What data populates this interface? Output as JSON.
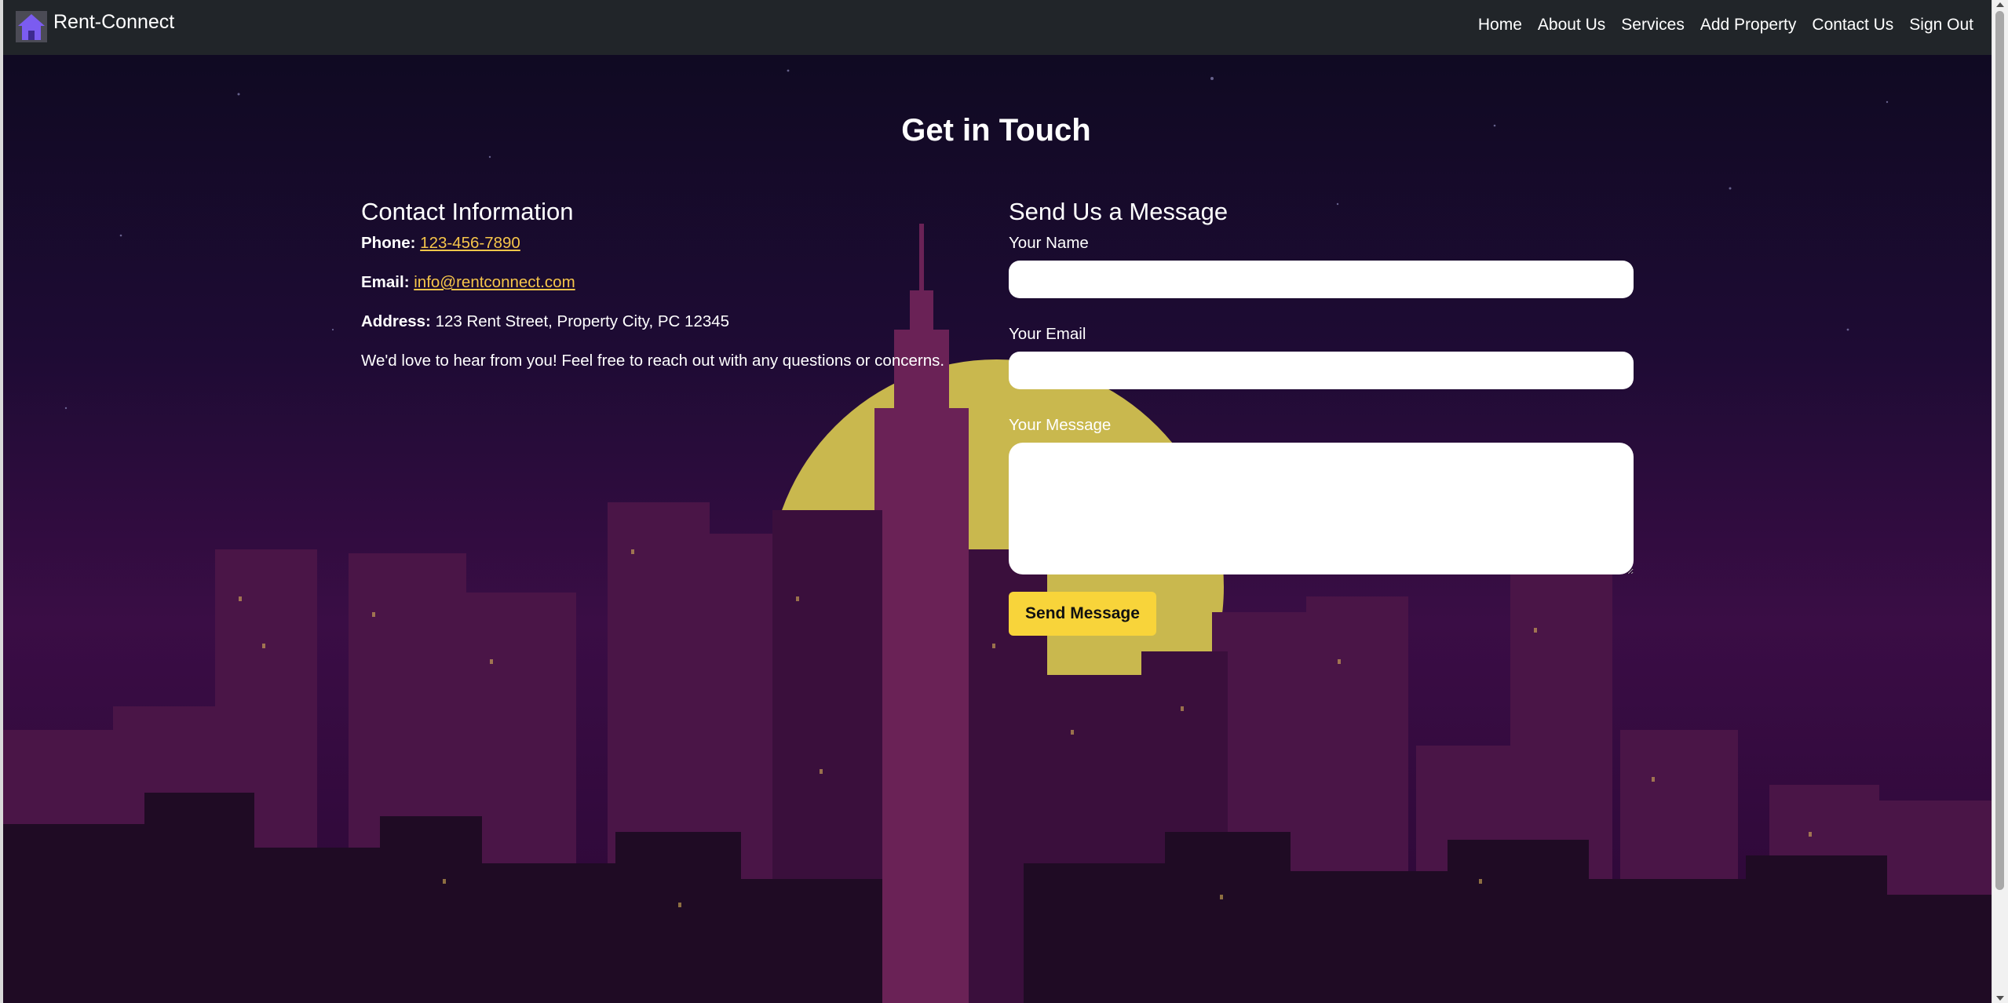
{
  "navbar": {
    "brand": "Rent-Connect",
    "brand_icon": "house-icon",
    "links": [
      "Home",
      "About Us",
      "Services",
      "Add Property",
      "Contact Us",
      "Sign Out"
    ]
  },
  "page": {
    "title": "Get in Touch"
  },
  "contact_info": {
    "heading": "Contact Information",
    "phone_label": "Phone:",
    "phone": "123-456-7890",
    "email_label": "Email:",
    "email": "info@rentconnect.com",
    "address_label": "Address:",
    "address": "123 Rent Street, Property City, PC 12345",
    "note": "We'd love to hear from you! Feel free to reach out with any questions or concerns."
  },
  "form": {
    "heading": "Send Us a Message",
    "name_label": "Your Name",
    "name_value": "",
    "email_label": "Your Email",
    "email_value": "",
    "message_label": "Your Message",
    "message_value": "",
    "submit_label": "Send Message"
  },
  "colors": {
    "navbar_bg": "#212529",
    "link_accent": "#f7c64a",
    "button_bg": "#f8d43a",
    "moon": "#c9b84e"
  }
}
